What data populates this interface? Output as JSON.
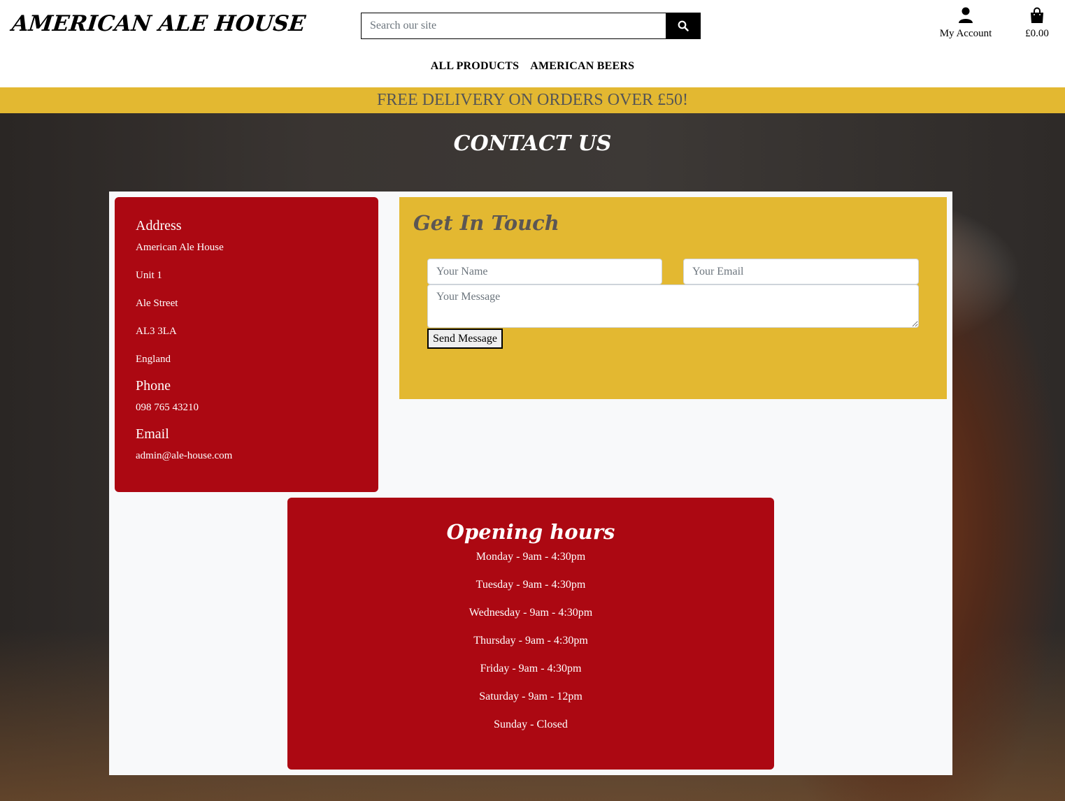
{
  "header": {
    "logo": "AMERICAN ALE HOUSE",
    "search_placeholder": "Search our site",
    "account_label": "My Account",
    "bag_total": "£0.00"
  },
  "nav": {
    "items": [
      {
        "label": "ALL PRODUCTS"
      },
      {
        "label": "AMERICAN BEERS"
      }
    ]
  },
  "banner": {
    "text": "FREE DELIVERY ON ORDERS OVER £50!"
  },
  "page": {
    "title": "CONTACT US"
  },
  "contact_info": {
    "address_heading": "Address",
    "address_lines": [
      "American Ale House",
      "Unit 1",
      "Ale Street",
      "AL3 3LA",
      "England"
    ],
    "phone_heading": "Phone",
    "phone": "098 765 43210",
    "email_heading": "Email",
    "email": "admin@ale-house.com"
  },
  "form": {
    "heading": "Get In Touch",
    "name_placeholder": "Your Name",
    "email_placeholder": "Your Email",
    "message_placeholder": "Your Message",
    "submit_label": "Send Message"
  },
  "hours": {
    "heading": "Opening hours",
    "days": [
      "Monday - 9am - 4:30pm",
      "Tuesday - 9am - 4:30pm",
      "Wednesday - 9am - 4:30pm",
      "Thursday - 9am - 4:30pm",
      "Friday - 9am - 4:30pm",
      "Saturday - 9am - 12pm",
      "Sunday - Closed"
    ]
  },
  "colors": {
    "brand_red": "#ac0812",
    "brand_gold": "#e3b831"
  }
}
